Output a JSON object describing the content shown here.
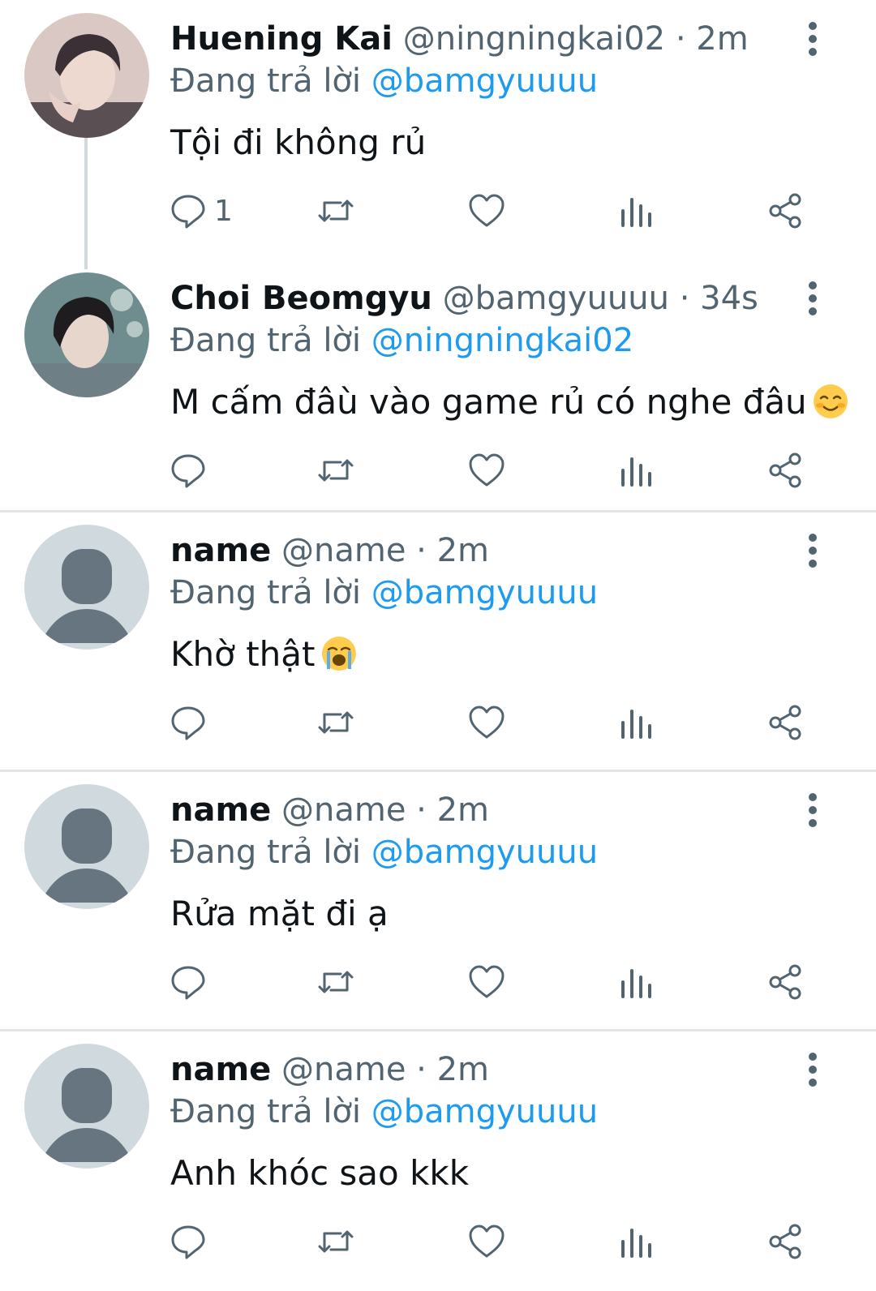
{
  "colors": {
    "accent": "#1d9bf0",
    "secondary_text": "#536471",
    "primary_text": "#0f1419",
    "separator": "#e3e6e8"
  },
  "reply_prefix": "Đang trả lời",
  "tweets": [
    {
      "name": "Huening Kai",
      "handle": "@ningningkai02",
      "dot": "·",
      "time": "2m",
      "reply_to": "@bamgyuuuu",
      "text": "Tội đi không rủ",
      "emoji": "",
      "reply_count": "1",
      "avatar": "photo-person-1"
    },
    {
      "name": "Choi Beomgyu",
      "handle": "@bamgyuuuu",
      "dot": "·",
      "time": "34s",
      "reply_to": "@ningningkai02",
      "text": "M cấm đâù vào game rủ có nghe đâu",
      "emoji": "smiling-face-emoji",
      "reply_count": "",
      "avatar": "photo-person-2"
    },
    {
      "name": "name",
      "handle": "@name",
      "dot": "·",
      "time": "2m",
      "reply_to": "@bamgyuuuu",
      "text": "Khờ thật",
      "emoji": "crying-face-emoji",
      "reply_count": "",
      "avatar": "default-avatar"
    },
    {
      "name": "name",
      "handle": "@name",
      "dot": "·",
      "time": "2m",
      "reply_to": "@bamgyuuuu",
      "text": "Rửa mặt đi ạ",
      "emoji": "",
      "reply_count": "",
      "avatar": "default-avatar"
    },
    {
      "name": "name",
      "handle": "@name",
      "dot": "·",
      "time": "2m",
      "reply_to": "@bamgyuuuu",
      "text": "Anh khóc sao kkk",
      "emoji": "",
      "reply_count": "",
      "avatar": "default-avatar"
    }
  ],
  "icons": [
    "reply-icon",
    "retweet-icon",
    "like-icon",
    "views-icon",
    "share-icon",
    "more-options-icon"
  ]
}
